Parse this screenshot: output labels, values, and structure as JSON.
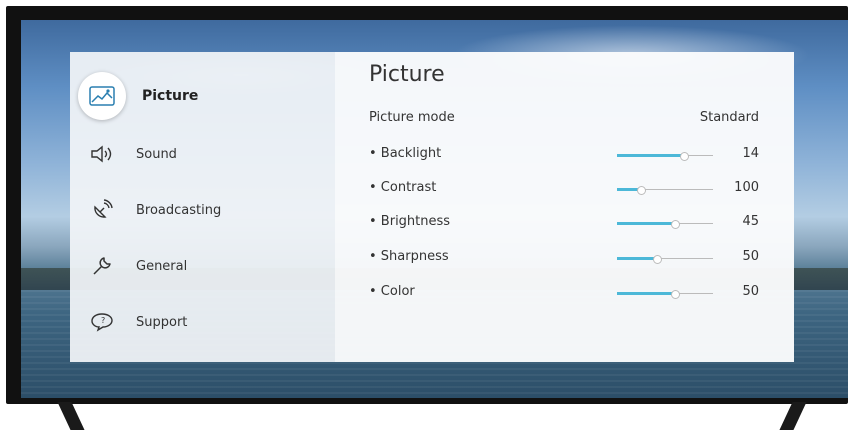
{
  "sidebar": {
    "items": [
      {
        "label": "Picture",
        "icon": "picture-icon",
        "active": true
      },
      {
        "label": "Sound",
        "icon": "speaker-icon"
      },
      {
        "label": "Broadcasting",
        "icon": "satellite-icon"
      },
      {
        "label": "General",
        "icon": "wrench-icon"
      },
      {
        "label": "Support",
        "icon": "speech-bubble-icon"
      }
    ]
  },
  "panel": {
    "title": "Picture",
    "picture_mode": {
      "label": "Picture mode",
      "value": "Standard"
    },
    "settings": [
      {
        "label": "• Backlight",
        "value": "14",
        "level": 0.7
      },
      {
        "label": "• Contrast",
        "value": "100",
        "level": 0.25
      },
      {
        "label": "• Brightness",
        "value": "45",
        "level": 0.6
      },
      {
        "label": "• Sharpness",
        "value": "50",
        "level": 0.42
      },
      {
        "label": "• Color",
        "value": "50",
        "level": 0.6
      }
    ]
  },
  "colors": {
    "accent": "#4cb8d8",
    "panel_bg": "#f9fafb",
    "sidebar_bg": "#eef1f4"
  }
}
